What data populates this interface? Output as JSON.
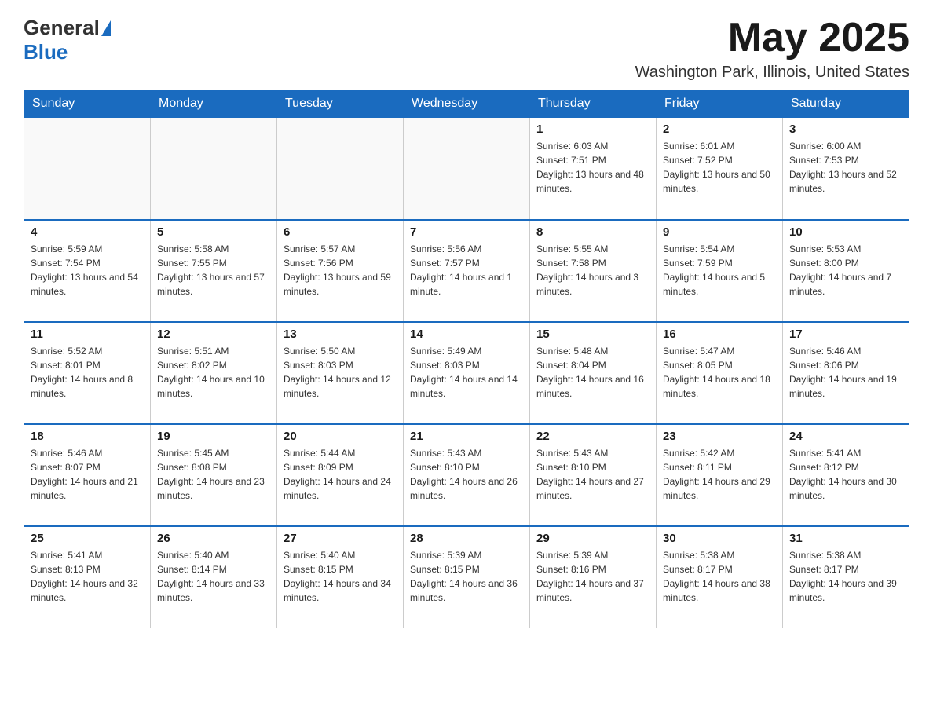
{
  "header": {
    "logo": {
      "text_general": "General",
      "text_blue": "Blue"
    },
    "title": "May 2025",
    "location": "Washington Park, Illinois, United States"
  },
  "days_of_week": [
    "Sunday",
    "Monday",
    "Tuesday",
    "Wednesday",
    "Thursday",
    "Friday",
    "Saturday"
  ],
  "weeks": [
    [
      {
        "day": "",
        "info": ""
      },
      {
        "day": "",
        "info": ""
      },
      {
        "day": "",
        "info": ""
      },
      {
        "day": "",
        "info": ""
      },
      {
        "day": "1",
        "info": "Sunrise: 6:03 AM\nSunset: 7:51 PM\nDaylight: 13 hours and 48 minutes."
      },
      {
        "day": "2",
        "info": "Sunrise: 6:01 AM\nSunset: 7:52 PM\nDaylight: 13 hours and 50 minutes."
      },
      {
        "day": "3",
        "info": "Sunrise: 6:00 AM\nSunset: 7:53 PM\nDaylight: 13 hours and 52 minutes."
      }
    ],
    [
      {
        "day": "4",
        "info": "Sunrise: 5:59 AM\nSunset: 7:54 PM\nDaylight: 13 hours and 54 minutes."
      },
      {
        "day": "5",
        "info": "Sunrise: 5:58 AM\nSunset: 7:55 PM\nDaylight: 13 hours and 57 minutes."
      },
      {
        "day": "6",
        "info": "Sunrise: 5:57 AM\nSunset: 7:56 PM\nDaylight: 13 hours and 59 minutes."
      },
      {
        "day": "7",
        "info": "Sunrise: 5:56 AM\nSunset: 7:57 PM\nDaylight: 14 hours and 1 minute."
      },
      {
        "day": "8",
        "info": "Sunrise: 5:55 AM\nSunset: 7:58 PM\nDaylight: 14 hours and 3 minutes."
      },
      {
        "day": "9",
        "info": "Sunrise: 5:54 AM\nSunset: 7:59 PM\nDaylight: 14 hours and 5 minutes."
      },
      {
        "day": "10",
        "info": "Sunrise: 5:53 AM\nSunset: 8:00 PM\nDaylight: 14 hours and 7 minutes."
      }
    ],
    [
      {
        "day": "11",
        "info": "Sunrise: 5:52 AM\nSunset: 8:01 PM\nDaylight: 14 hours and 8 minutes."
      },
      {
        "day": "12",
        "info": "Sunrise: 5:51 AM\nSunset: 8:02 PM\nDaylight: 14 hours and 10 minutes."
      },
      {
        "day": "13",
        "info": "Sunrise: 5:50 AM\nSunset: 8:03 PM\nDaylight: 14 hours and 12 minutes."
      },
      {
        "day": "14",
        "info": "Sunrise: 5:49 AM\nSunset: 8:03 PM\nDaylight: 14 hours and 14 minutes."
      },
      {
        "day": "15",
        "info": "Sunrise: 5:48 AM\nSunset: 8:04 PM\nDaylight: 14 hours and 16 minutes."
      },
      {
        "day": "16",
        "info": "Sunrise: 5:47 AM\nSunset: 8:05 PM\nDaylight: 14 hours and 18 minutes."
      },
      {
        "day": "17",
        "info": "Sunrise: 5:46 AM\nSunset: 8:06 PM\nDaylight: 14 hours and 19 minutes."
      }
    ],
    [
      {
        "day": "18",
        "info": "Sunrise: 5:46 AM\nSunset: 8:07 PM\nDaylight: 14 hours and 21 minutes."
      },
      {
        "day": "19",
        "info": "Sunrise: 5:45 AM\nSunset: 8:08 PM\nDaylight: 14 hours and 23 minutes."
      },
      {
        "day": "20",
        "info": "Sunrise: 5:44 AM\nSunset: 8:09 PM\nDaylight: 14 hours and 24 minutes."
      },
      {
        "day": "21",
        "info": "Sunrise: 5:43 AM\nSunset: 8:10 PM\nDaylight: 14 hours and 26 minutes."
      },
      {
        "day": "22",
        "info": "Sunrise: 5:43 AM\nSunset: 8:10 PM\nDaylight: 14 hours and 27 minutes."
      },
      {
        "day": "23",
        "info": "Sunrise: 5:42 AM\nSunset: 8:11 PM\nDaylight: 14 hours and 29 minutes."
      },
      {
        "day": "24",
        "info": "Sunrise: 5:41 AM\nSunset: 8:12 PM\nDaylight: 14 hours and 30 minutes."
      }
    ],
    [
      {
        "day": "25",
        "info": "Sunrise: 5:41 AM\nSunset: 8:13 PM\nDaylight: 14 hours and 32 minutes."
      },
      {
        "day": "26",
        "info": "Sunrise: 5:40 AM\nSunset: 8:14 PM\nDaylight: 14 hours and 33 minutes."
      },
      {
        "day": "27",
        "info": "Sunrise: 5:40 AM\nSunset: 8:15 PM\nDaylight: 14 hours and 34 minutes."
      },
      {
        "day": "28",
        "info": "Sunrise: 5:39 AM\nSunset: 8:15 PM\nDaylight: 14 hours and 36 minutes."
      },
      {
        "day": "29",
        "info": "Sunrise: 5:39 AM\nSunset: 8:16 PM\nDaylight: 14 hours and 37 minutes."
      },
      {
        "day": "30",
        "info": "Sunrise: 5:38 AM\nSunset: 8:17 PM\nDaylight: 14 hours and 38 minutes."
      },
      {
        "day": "31",
        "info": "Sunrise: 5:38 AM\nSunset: 8:17 PM\nDaylight: 14 hours and 39 minutes."
      }
    ]
  ]
}
